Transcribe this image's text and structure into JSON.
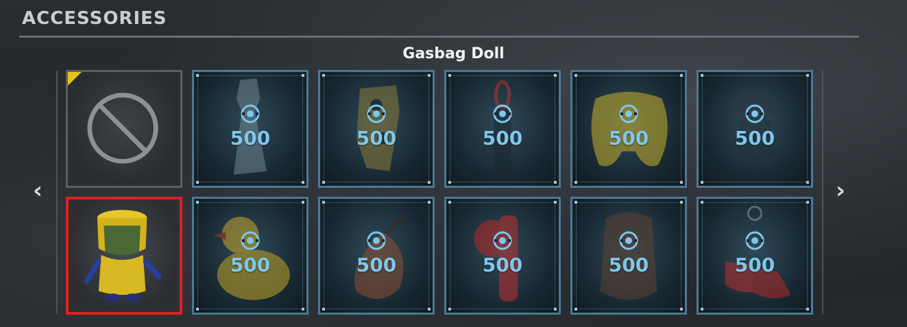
{
  "section": {
    "title": "ACCESSORIES"
  },
  "selected_item": {
    "name": "Gasbag Doll"
  },
  "nav": {
    "prev": "‹",
    "next": "›"
  },
  "currency": {
    "icon": "coin-icon",
    "color": "#7fc6ea"
  },
  "items": [
    {
      "id": "none",
      "price": null
    },
    {
      "id": "plastic-bag",
      "price": "500"
    },
    {
      "id": "brass-knuckle-mask",
      "price": "500"
    },
    {
      "id": "carabiner-flashlight",
      "price": "500"
    },
    {
      "id": "yellow-gamepad",
      "price": "500"
    },
    {
      "id": "dark-figure",
      "price": "500"
    },
    {
      "id": "gasbag-doll",
      "price": null
    },
    {
      "id": "rubber-duck",
      "price": "500"
    },
    {
      "id": "leather-pouch",
      "price": "500"
    },
    {
      "id": "red-fire-extinguisher",
      "price": "500"
    },
    {
      "id": "baseball-glove",
      "price": "500"
    },
    {
      "id": "red-sneakers",
      "price": "500"
    }
  ]
}
